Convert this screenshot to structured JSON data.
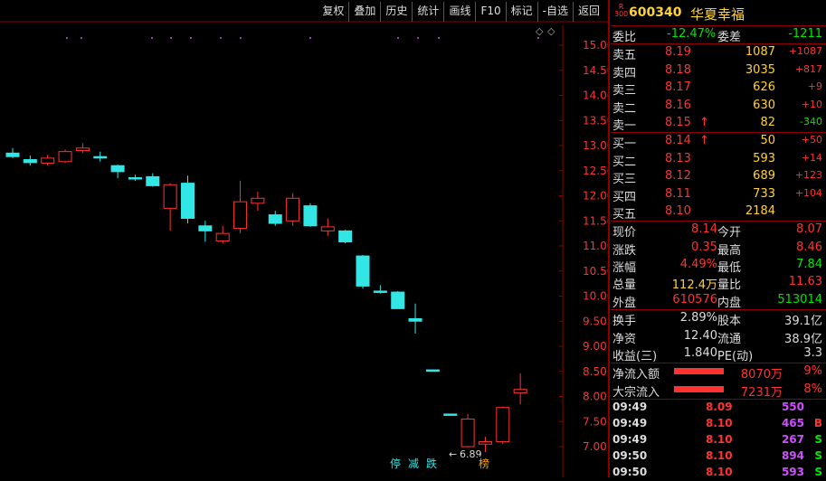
{
  "toolbar": [
    "复权",
    "叠加",
    "历史",
    "统计",
    "画线",
    "F10",
    "标记",
    "-自选",
    "返回"
  ],
  "stock": {
    "tag_top": "R",
    "tag_bottom": "300",
    "code": "600340",
    "name": "华夏幸福"
  },
  "weibi": {
    "label": "委比",
    "value": "-12.47%",
    "label2": "委差",
    "value2": "-1211"
  },
  "sells": [
    {
      "label": "卖五",
      "price": "8.19",
      "vol": "1087",
      "chg": "+1087",
      "arrow": ""
    },
    {
      "label": "卖四",
      "price": "8.18",
      "vol": "3035",
      "chg": "+817",
      "arrow": ""
    },
    {
      "label": "卖三",
      "price": "8.17",
      "vol": "626",
      "chg": "+9",
      "arrow": ""
    },
    {
      "label": "卖二",
      "price": "8.16",
      "vol": "630",
      "chg": "+10",
      "arrow": ""
    },
    {
      "label": "卖一",
      "price": "8.15",
      "vol": "82",
      "chg": "-340",
      "arrow": "↑"
    }
  ],
  "buys": [
    {
      "label": "买一",
      "price": "8.14",
      "vol": "50",
      "chg": "+50",
      "arrow": "↑"
    },
    {
      "label": "买二",
      "price": "8.13",
      "vol": "593",
      "chg": "+14",
      "arrow": ""
    },
    {
      "label": "买三",
      "price": "8.12",
      "vol": "689",
      "chg": "+123",
      "arrow": ""
    },
    {
      "label": "买四",
      "price": "8.11",
      "vol": "733",
      "chg": "+104",
      "arrow": ""
    },
    {
      "label": "买五",
      "price": "8.10",
      "vol": "2184",
      "chg": "",
      "arrow": ""
    }
  ],
  "quote": [
    {
      "l1": "现价",
      "v1": "8.14",
      "l2": "今开",
      "v2": "8.07"
    },
    {
      "l1": "涨跌",
      "v1": "0.35",
      "l2": "最高",
      "v2": "8.46"
    },
    {
      "l1": "涨幅",
      "v1": "4.49%",
      "l2": "最低",
      "v2": "7.84"
    },
    {
      "l1": "总量",
      "v1": "112.4万",
      "l2": "量比",
      "v2": "11.63"
    },
    {
      "l1": "外盘",
      "v1": "610576",
      "l2": "内盘",
      "v2": "513014"
    }
  ],
  "fund": [
    {
      "l1": "换手",
      "v1": "2.89%",
      "l2": "股本",
      "v2": "39.1亿"
    },
    {
      "l1": "净资",
      "v1": "12.40",
      "l2": "流通",
      "v2": "38.9亿"
    },
    {
      "l1": "收益(三)",
      "v1": "1.840",
      "l2": "PE(动)",
      "v2": "3.3"
    }
  ],
  "flows": [
    {
      "label": "净流入额",
      "value": "8070万",
      "pct": "9%"
    },
    {
      "label": "大宗流入",
      "value": "7231万",
      "pct": "8%"
    }
  ],
  "ticks": [
    {
      "time": "09:49",
      "price": "8.09",
      "vol": "550",
      "flag": ""
    },
    {
      "time": "09:49",
      "price": "8.10",
      "vol": "465",
      "flag": "B"
    },
    {
      "time": "09:49",
      "price": "8.10",
      "vol": "267",
      "flag": "S"
    },
    {
      "time": "09:50",
      "price": "8.10",
      "vol": "894",
      "flag": "S"
    },
    {
      "time": "09:50",
      "price": "8.10",
      "vol": "593",
      "flag": "S"
    }
  ],
  "chart_data": {
    "type": "candlestick",
    "y_ticks": [
      "15.00",
      "14.50",
      "14.00",
      "13.50",
      "13.00",
      "12.50",
      "12.00",
      "11.50",
      "11.00",
      "10.50",
      "10.00",
      "9.50",
      "9.00",
      "8.50",
      "8.00",
      "7.50",
      "7.00"
    ],
    "low_annotation": "6.89",
    "markers": [
      "停",
      "减",
      "跌",
      "榜"
    ],
    "candles": [
      {
        "o": 12.85,
        "h": 12.95,
        "l": 12.75,
        "c": 12.78,
        "up": false
      },
      {
        "o": 12.72,
        "h": 12.8,
        "l": 12.6,
        "c": 12.66,
        "up": false
      },
      {
        "o": 12.65,
        "h": 12.82,
        "l": 12.6,
        "c": 12.75,
        "up": true
      },
      {
        "o": 12.68,
        "h": 12.92,
        "l": 12.65,
        "c": 12.88,
        "up": true
      },
      {
        "o": 12.9,
        "h": 13.05,
        "l": 12.85,
        "c": 12.95,
        "up": true
      },
      {
        "o": 12.78,
        "h": 12.88,
        "l": 12.68,
        "c": 12.76,
        "up": false
      },
      {
        "o": 12.6,
        "h": 12.62,
        "l": 12.35,
        "c": 12.48,
        "up": false
      },
      {
        "o": 12.36,
        "h": 12.42,
        "l": 12.3,
        "c": 12.34,
        "up": false
      },
      {
        "o": 12.38,
        "h": 12.45,
        "l": 12.18,
        "c": 12.2,
        "up": false
      },
      {
        "o": 11.75,
        "h": 12.25,
        "l": 11.3,
        "c": 12.22,
        "up": true
      },
      {
        "o": 12.25,
        "h": 12.4,
        "l": 11.45,
        "c": 11.55,
        "up": false
      },
      {
        "o": 11.4,
        "h": 11.5,
        "l": 11.08,
        "c": 11.3,
        "up": false
      },
      {
        "o": 11.1,
        "h": 11.4,
        "l": 11.05,
        "c": 11.25,
        "up": true
      },
      {
        "o": 11.35,
        "h": 12.3,
        "l": 11.25,
        "c": 11.88,
        "up": true
      },
      {
        "o": 11.85,
        "h": 12.08,
        "l": 11.7,
        "c": 11.95,
        "up": true
      },
      {
        "o": 11.62,
        "h": 11.7,
        "l": 11.4,
        "c": 11.45,
        "up": false
      },
      {
        "o": 11.5,
        "h": 12.05,
        "l": 11.4,
        "c": 11.95,
        "up": true
      },
      {
        "o": 11.8,
        "h": 11.85,
        "l": 11.38,
        "c": 11.4,
        "up": false
      },
      {
        "o": 11.3,
        "h": 11.55,
        "l": 11.2,
        "c": 11.38,
        "up": true
      },
      {
        "o": 11.3,
        "h": 11.32,
        "l": 11.05,
        "c": 11.08,
        "up": false
      },
      {
        "o": 10.8,
        "h": 10.82,
        "l": 10.15,
        "c": 10.2,
        "up": false
      },
      {
        "o": 10.1,
        "h": 10.22,
        "l": 10.05,
        "c": 10.08,
        "up": false
      },
      {
        "o": 10.08,
        "h": 10.1,
        "l": 9.75,
        "c": 9.75,
        "up": false
      },
      {
        "o": 9.55,
        "h": 9.85,
        "l": 9.25,
        "c": 9.5,
        "up": false
      },
      {
        "o": 8.53,
        "h": 8.53,
        "l": 8.53,
        "c": 8.53,
        "up": false
      },
      {
        "o": 7.65,
        "h": 7.65,
        "l": 7.65,
        "c": 7.65,
        "up": false
      },
      {
        "o": 7.0,
        "h": 7.65,
        "l": 6.98,
        "c": 7.55,
        "up": true
      },
      {
        "o": 7.05,
        "h": 7.2,
        "l": 6.89,
        "c": 7.1,
        "up": true
      },
      {
        "o": 7.1,
        "h": 7.8,
        "l": 7.05,
        "c": 7.78,
        "up": true
      },
      {
        "o": 8.07,
        "h": 8.46,
        "l": 7.84,
        "c": 8.14,
        "up": true
      }
    ]
  }
}
